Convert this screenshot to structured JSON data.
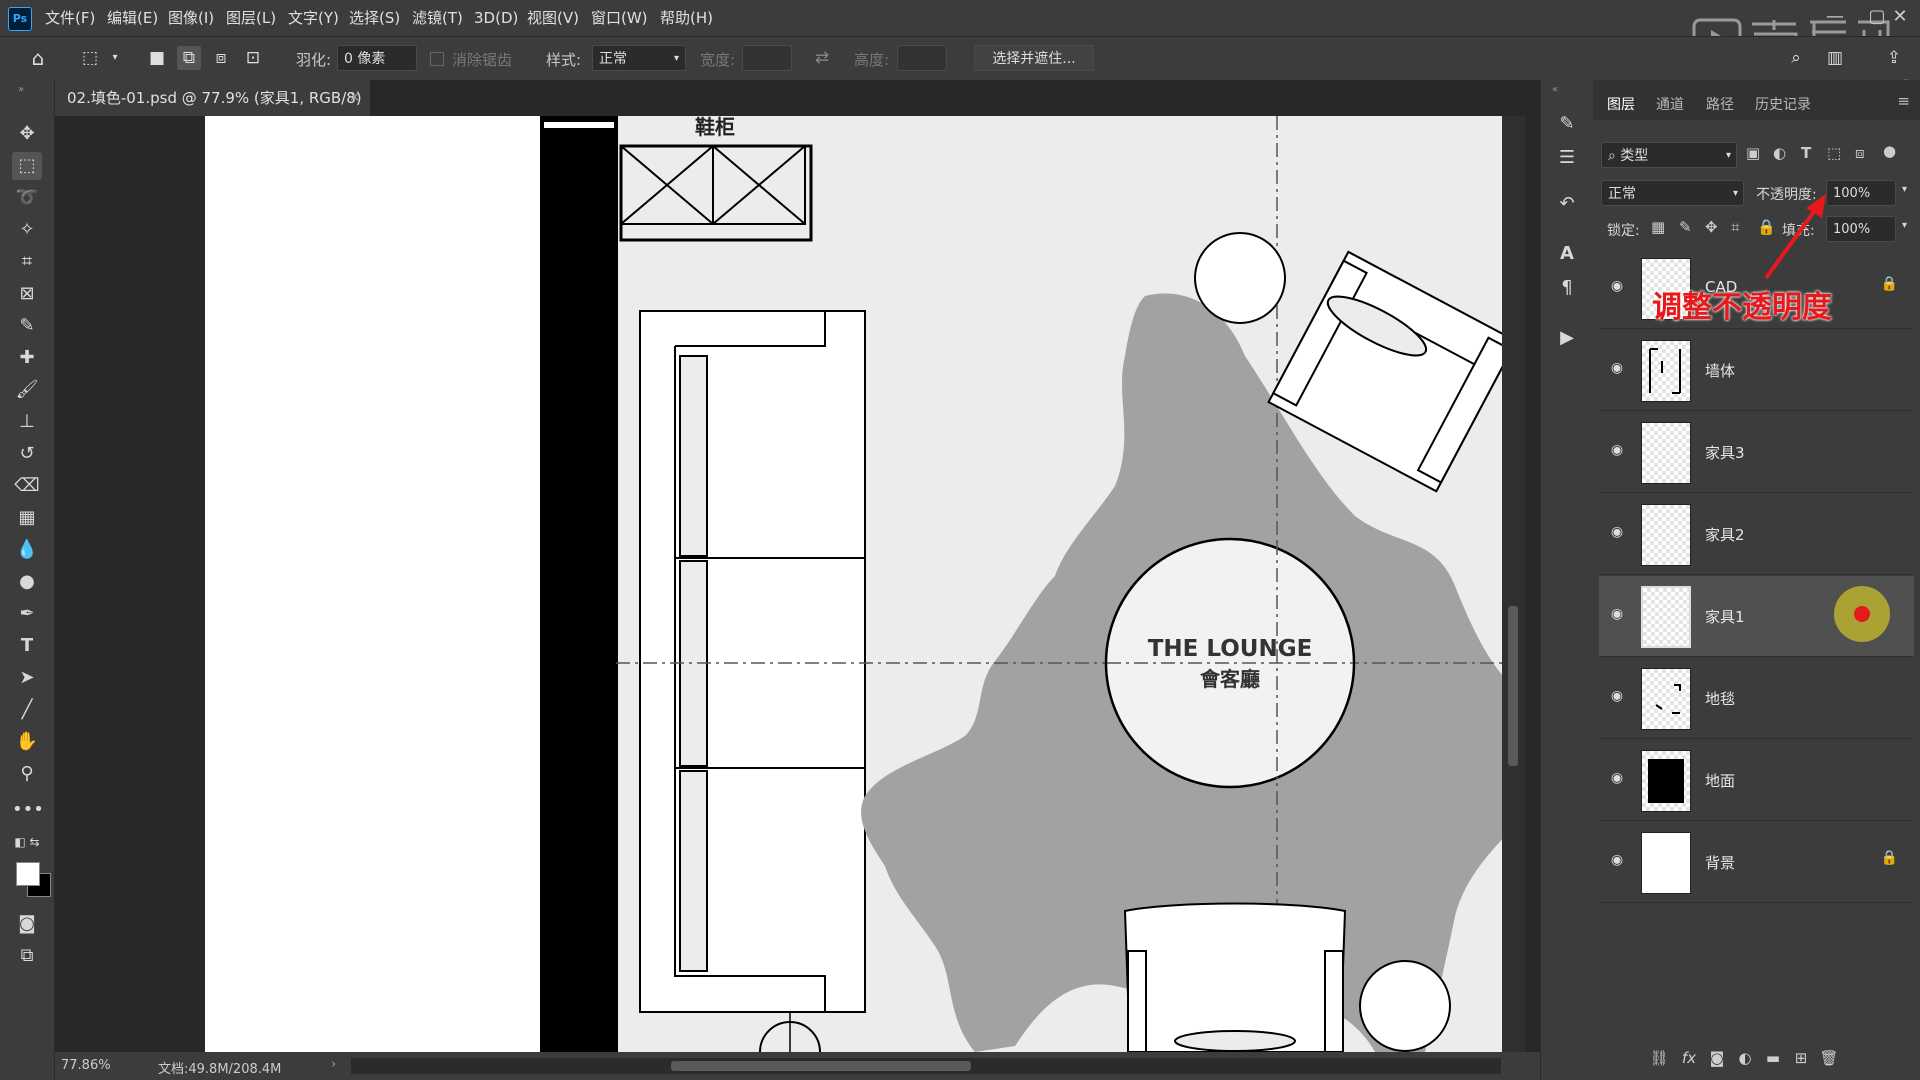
{
  "app": {
    "logo": "Ps"
  },
  "menu": [
    "文件(F)",
    "编辑(E)",
    "图像(I)",
    "图层(L)",
    "文字(Y)",
    "选择(S)",
    "滤镜(T)",
    "3D(D)",
    "视图(V)",
    "窗口(W)",
    "帮助(H)"
  ],
  "options": {
    "feather_label": "羽化:",
    "feather_value": "0 像素",
    "antialias_label": "消除锯齿",
    "style_label": "样式:",
    "style_value": "正常",
    "width_label": "宽度:",
    "height_label": "高度:",
    "select_mask_label": "选择并遮住..."
  },
  "document": {
    "tab_title": "02.填色-01.psd @ 77.9% (家具1, RGB/8) *",
    "close_glyph": "×"
  },
  "drawing": {
    "shoe_cabinet_label": "鞋柜",
    "lounge_title": "THE LOUNGE",
    "lounge_subtitle": "會客廳"
  },
  "status": {
    "zoom": "77.86%",
    "doc_size": "文档:49.8M/208.4M"
  },
  "panel": {
    "tabs": [
      "图层",
      "通道",
      "路径",
      "历史记录"
    ],
    "filter_kind": "类型",
    "blend_mode": "正常",
    "opacity_label": "不透明度:",
    "opacity_value": "100%",
    "lock_label": "锁定:",
    "fill_label": "填充:",
    "fill_value": "100%",
    "layers": [
      {
        "name": "CAD",
        "locked": true,
        "selected": false
      },
      {
        "name": "墙体",
        "locked": false,
        "selected": false
      },
      {
        "name": "家具3",
        "locked": false,
        "selected": false
      },
      {
        "name": "家具2",
        "locked": false,
        "selected": false
      },
      {
        "name": "家具1",
        "locked": false,
        "selected": true
      },
      {
        "name": "地毯",
        "locked": false,
        "selected": false
      },
      {
        "name": "地面",
        "locked": false,
        "selected": false
      },
      {
        "name": "背景",
        "locked": true,
        "selected": false
      }
    ]
  },
  "annotation": {
    "text": "调整不透明度",
    "color": "#e8191c"
  },
  "colors": {
    "ui_bg": "#3c3c3c",
    "dark_bg": "#282828",
    "rug": "#a2a2a2",
    "floor": "#ececec",
    "wall": "#000000"
  }
}
